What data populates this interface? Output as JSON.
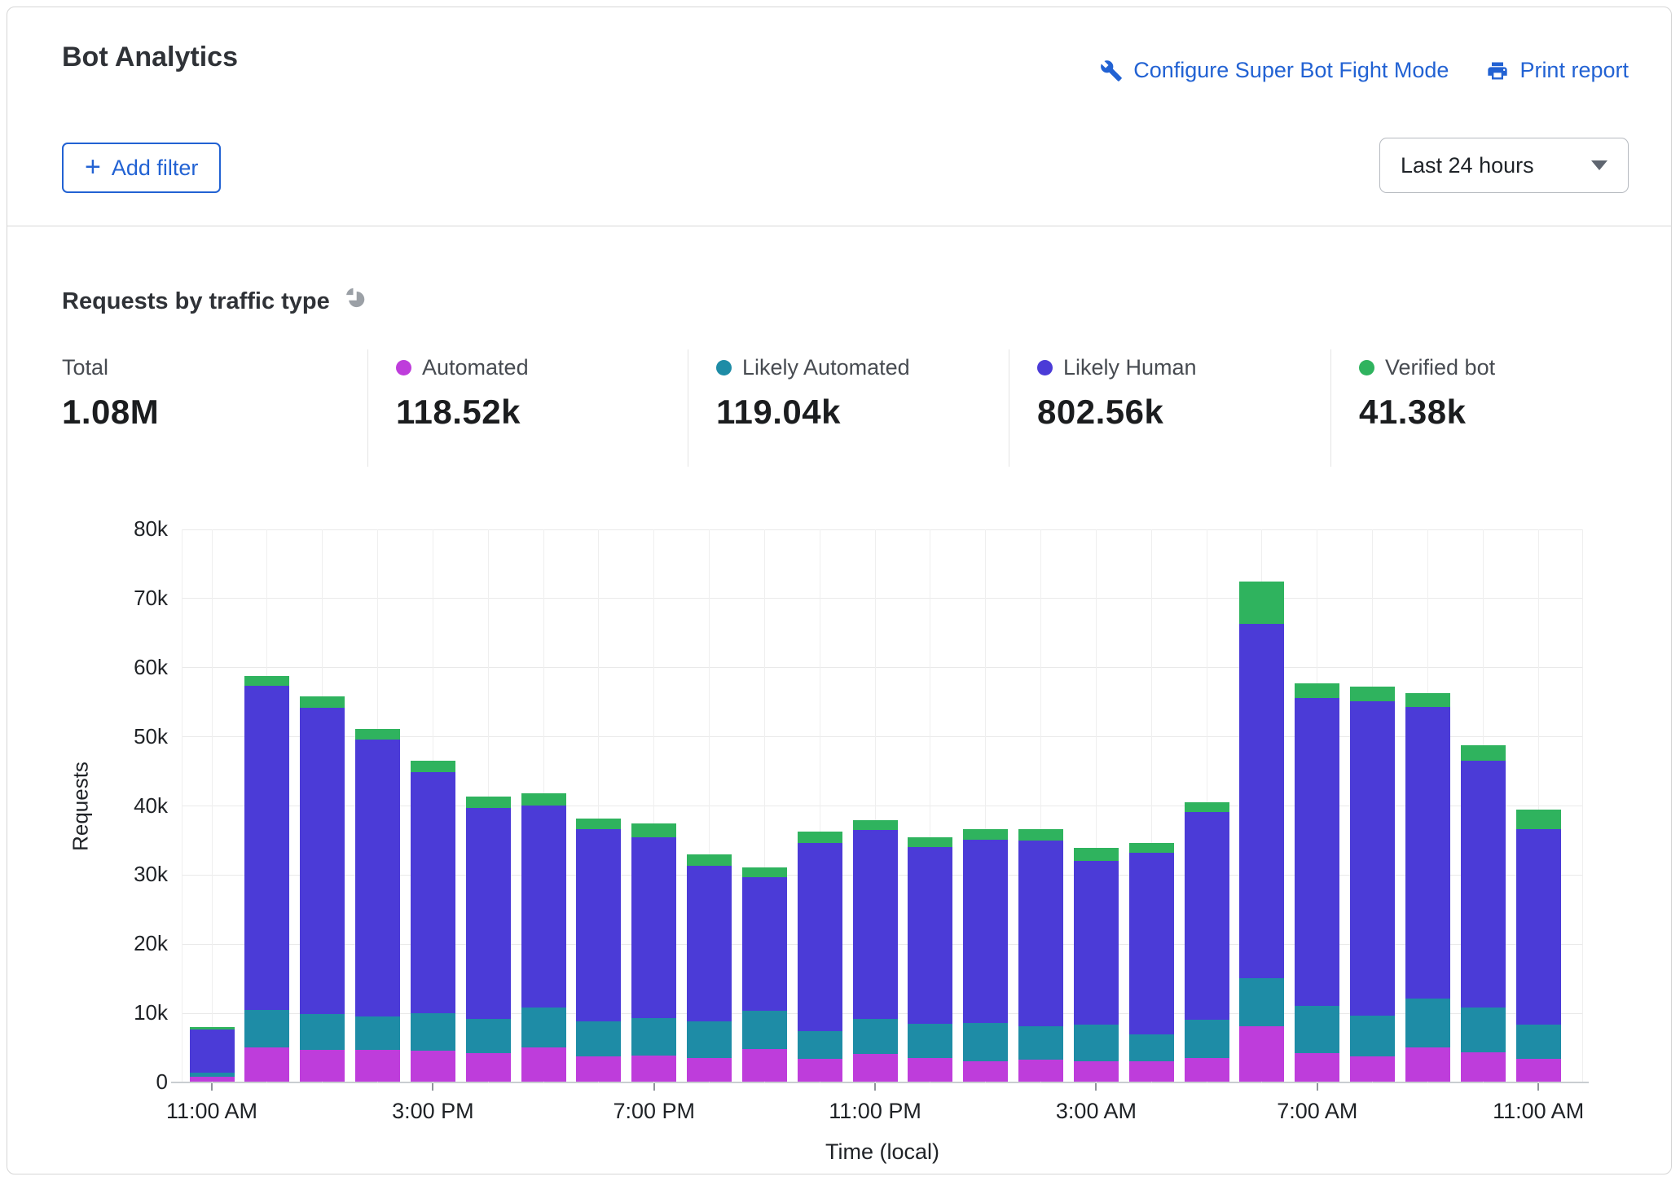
{
  "header": {
    "title": "Bot Analytics",
    "configure_label": "Configure Super Bot Fight Mode",
    "print_label": "Print report",
    "add_filter_label": "Add filter",
    "time_range_value": "Last 24 hours"
  },
  "panel": {
    "title": "Requests by traffic type"
  },
  "stats": [
    {
      "label": "Total",
      "value": "1.08M",
      "dot_color": null
    },
    {
      "label": "Automated",
      "value": "118.52k",
      "dot_color": "#be3ddb"
    },
    {
      "label": "Likely Automated",
      "value": "119.04k",
      "dot_color": "#1e8ca6"
    },
    {
      "label": "Likely Human",
      "value": "802.56k",
      "dot_color": "#4b3bd7"
    },
    {
      "label": "Verified bot",
      "value": "41.38k",
      "dot_color": "#2fb35e"
    }
  ],
  "chart_data": {
    "type": "bar",
    "stacked": true,
    "title": "Requests by traffic type",
    "xlabel": "Time (local)",
    "ylabel": "Requests",
    "ylim": [
      0,
      80000
    ],
    "grid": true,
    "legend_position": "top-stats-row",
    "yticks": {
      "values": [
        0,
        10000,
        20000,
        30000,
        40000,
        50000,
        60000,
        70000,
        80000
      ],
      "labels": [
        "0",
        "10k",
        "20k",
        "30k",
        "40k",
        "50k",
        "60k",
        "70k",
        "80k"
      ]
    },
    "categories": [
      "11:00 AM",
      "12:00 PM",
      "1:00 PM",
      "2:00 PM",
      "3:00 PM",
      "4:00 PM",
      "5:00 PM",
      "6:00 PM",
      "7:00 PM",
      "8:00 PM",
      "9:00 PM",
      "10:00 PM",
      "11:00 PM",
      "12:00 AM",
      "1:00 AM",
      "2:00 AM",
      "3:00 AM",
      "4:00 AM",
      "5:00 AM",
      "6:00 AM",
      "7:00 AM",
      "8:00 AM",
      "9:00 AM",
      "10:00 AM",
      "11:00 AM"
    ],
    "xticks": {
      "indices": [
        0,
        4,
        8,
        12,
        16,
        20,
        24
      ],
      "labels": [
        "11:00 AM",
        "3:00 PM",
        "7:00 PM",
        "11:00 PM",
        "3:00 AM",
        "7:00 AM",
        "11:00 AM"
      ]
    },
    "series": [
      {
        "name": "Automated",
        "color": "#be3ddb",
        "values": [
          700,
          5000,
          4600,
          4600,
          4500,
          4100,
          4900,
          3600,
          3800,
          3400,
          4700,
          3300,
          4000,
          3400,
          2900,
          3200,
          2900,
          2900,
          3400,
          8000,
          4100,
          3700,
          5000,
          4300,
          3300
        ]
      },
      {
        "name": "Likely Automated",
        "color": "#1e8ca6",
        "values": [
          600,
          5400,
          5200,
          4800,
          5400,
          5000,
          5800,
          5100,
          5400,
          5300,
          5600,
          4000,
          5100,
          5000,
          5600,
          4800,
          5400,
          3900,
          5500,
          7000,
          6900,
          5800,
          7000,
          6400,
          4900
        ]
      },
      {
        "name": "Likely Human",
        "color": "#4b3bd7",
        "values": [
          6300,
          46900,
          44300,
          40100,
          34900,
          30500,
          29300,
          27800,
          26200,
          22500,
          19300,
          27200,
          27300,
          25500,
          26500,
          26900,
          23600,
          26300,
          30100,
          51200,
          44500,
          45500,
          42200,
          35700,
          28300
        ]
      },
      {
        "name": "Verified bot",
        "color": "#2fb35e",
        "values": [
          300,
          1400,
          1600,
          1500,
          1600,
          1600,
          1700,
          1600,
          2000,
          1700,
          1400,
          1700,
          1400,
          1400,
          1500,
          1600,
          1900,
          1400,
          1400,
          6100,
          2100,
          2100,
          2000,
          2300,
          2800
        ]
      }
    ]
  }
}
